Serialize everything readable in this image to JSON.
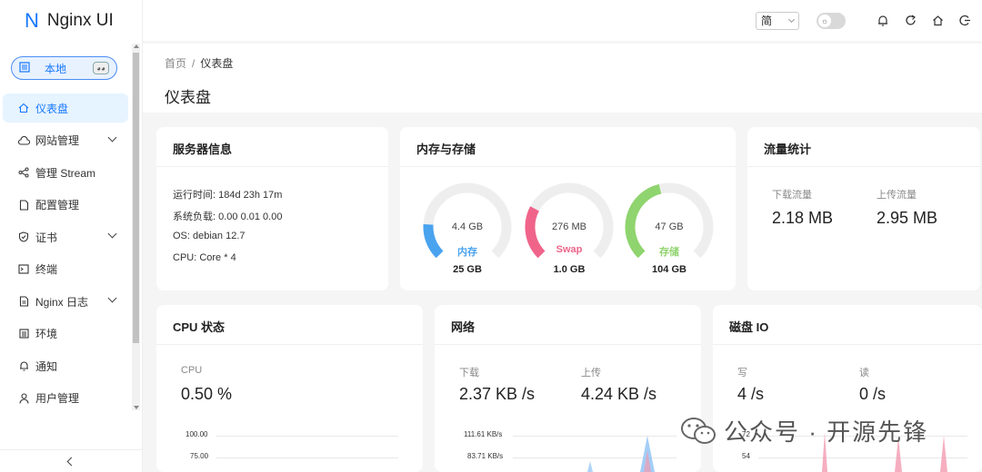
{
  "app": {
    "logo_letter": "N",
    "title": "Nginx UI"
  },
  "env": {
    "label": "本地"
  },
  "nav": [
    {
      "label": "仪表盘",
      "icon": "home-icon",
      "active": true,
      "expandable": false
    },
    {
      "label": "网站管理",
      "icon": "cloud-icon",
      "expandable": true
    },
    {
      "label": "管理 Stream",
      "icon": "share-icon",
      "expandable": false
    },
    {
      "label": "配置管理",
      "icon": "file-icon",
      "expandable": false
    },
    {
      "label": "证书",
      "icon": "shield-icon",
      "expandable": true
    },
    {
      "label": "终端",
      "icon": "terminal-icon",
      "expandable": false
    },
    {
      "label": "Nginx 日志",
      "icon": "log-icon",
      "expandable": true
    },
    {
      "label": "环境",
      "icon": "list-icon",
      "expandable": false
    },
    {
      "label": "通知",
      "icon": "bell-icon",
      "expandable": false
    },
    {
      "label": "用户管理",
      "icon": "user-icon",
      "expandable": false
    }
  ],
  "header": {
    "language": "简"
  },
  "breadcrumb": {
    "home": "首页",
    "sep": "/",
    "current": "仪表盘"
  },
  "page_title": "仪表盘",
  "server_info": {
    "title": "服务器信息",
    "uptime": "运行时间: 184d 23h 17m",
    "load": "系统负载: 0.00 0.01 0.00",
    "os": "OS: debian 12.7",
    "cpu": "CPU: Core * 4"
  },
  "memory": {
    "title": "内存与存储",
    "gauges": [
      {
        "value": "4.4 GB",
        "label": "内存",
        "total": "25 GB",
        "fraction": 0.18,
        "color": "#4aa3ef"
      },
      {
        "value": "276 MB",
        "label": "Swap",
        "total": "1.0 GB",
        "fraction": 0.27,
        "color": "#f0648a"
      },
      {
        "value": "47 GB",
        "label": "存储",
        "total": "104 GB",
        "fraction": 0.45,
        "color": "#8fd46e"
      }
    ]
  },
  "traffic": {
    "title": "流量统计",
    "download_label": "下载流量",
    "download_value": "2.18 MB",
    "upload_label": "上传流量",
    "upload_value": "2.95 MB"
  },
  "cpu": {
    "title": "CPU 状态",
    "label": "CPU",
    "value": "0.50 %",
    "axis": [
      "100.00",
      "75.00"
    ]
  },
  "network": {
    "title": "网络",
    "download_label": "下载",
    "download_value": "2.37 KB /s",
    "upload_label": "上传",
    "upload_value": "4.24 KB /s",
    "axis": [
      "111.61 KB/s",
      "83.71 KB/s"
    ]
  },
  "disk": {
    "title": "磁盘 IO",
    "write_label": "写",
    "write_value": "4 /s",
    "read_label": "读",
    "read_value": "0 /s",
    "axis": [
      "72",
      "54"
    ]
  },
  "watermark": {
    "text": "公众号 · 开源先锋"
  }
}
